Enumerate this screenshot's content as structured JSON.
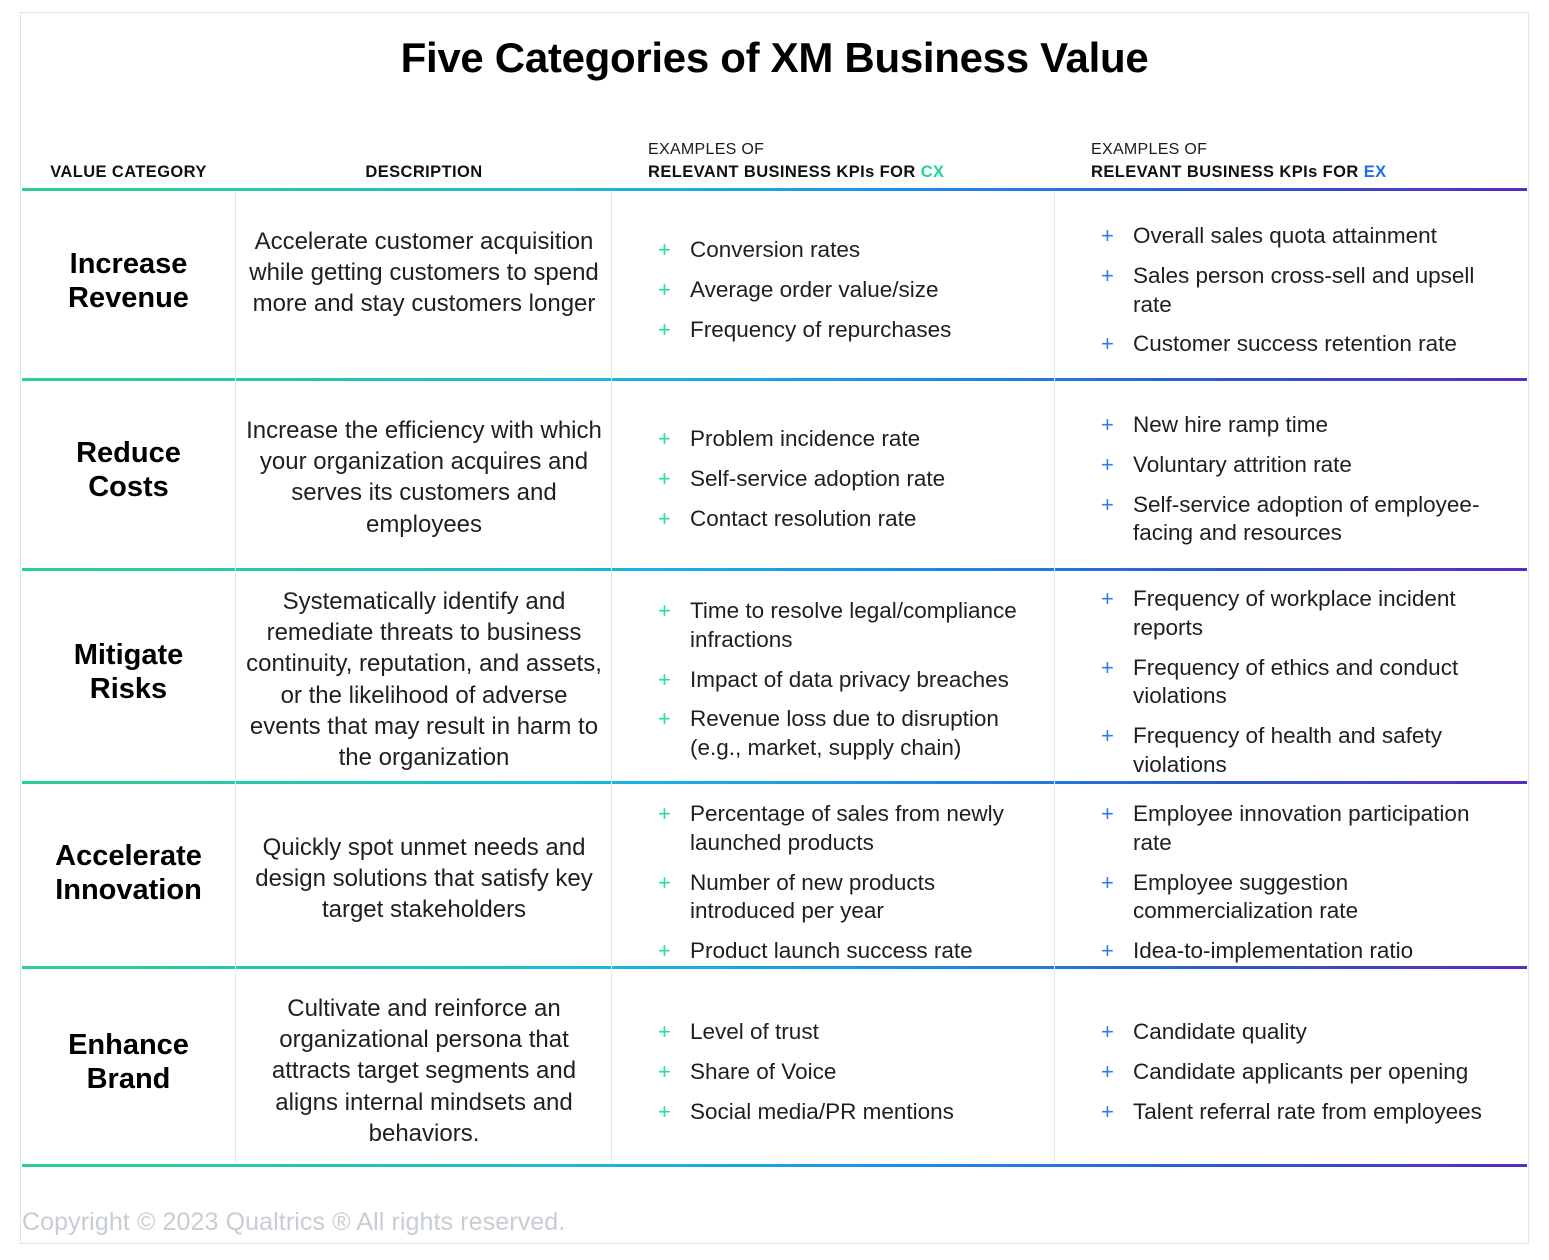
{
  "title": "Five Categories of XM Business Value",
  "colors": {
    "cx_accent": "#22D39B",
    "ex_accent": "#1E6FE8",
    "gradient_start": "#2BD18F",
    "gradient_end": "#5B2AC2",
    "footer_text": "#c7cdd3"
  },
  "columns": {
    "category": {
      "label": "VALUE CATEGORY",
      "eyebrow": ""
    },
    "description": {
      "label": "DESCRIPTION",
      "eyebrow": ""
    },
    "cx": {
      "eyebrow": "EXAMPLES OF",
      "label_prefix": "RELEVANT BUSINESS KPIs FOR ",
      "accent": "CX"
    },
    "ex": {
      "eyebrow": "EXAMPLES OF",
      "label_prefix": "RELEVANT BUSINESS KPIs FOR ",
      "accent": "EX"
    }
  },
  "rows": [
    {
      "category": "Increase\nRevenue",
      "description": "Accelerate customer acquisition while getting customers to spend more and stay customers longer",
      "cx": [
        "Conversion rates",
        "Average order value/size",
        "Frequency of repurchases"
      ],
      "ex": [
        "Overall sales quota attainment",
        "Sales person cross-sell and upsell rate",
        "Customer success retention rate"
      ]
    },
    {
      "category": "Reduce\nCosts",
      "description": "Increase the efficiency with which your organization acquires and serves its customers and employees",
      "cx": [
        "Problem incidence rate",
        "Self-service adoption rate",
        "Contact resolution rate"
      ],
      "ex": [
        "New hire ramp time",
        "Voluntary attrition rate",
        "Self-service adoption of employee-facing and resources"
      ]
    },
    {
      "category": "Mitigate\nRisks",
      "description": "Systematically identify and remediate threats to business continuity, reputation, and assets, or the likelihood of adverse events that may result in harm to the organization",
      "cx": [
        "Time to resolve legal/compliance infractions",
        "Impact of data privacy breaches",
        "Revenue loss due to disruption (e.g., market, supply chain)"
      ],
      "ex": [
        "Frequency of workplace incident reports",
        "Frequency of ethics and conduct violations",
        "Frequency of health and safety violations"
      ]
    },
    {
      "category": "Accelerate\nInnovation",
      "description": "Quickly spot unmet needs and design solutions that satisfy key target stakeholders",
      "cx": [
        "Percentage of sales from newly launched products",
        "Number of new products introduced per year",
        "Product launch success rate"
      ],
      "ex": [
        "Employee innovation participation rate",
        "Employee suggestion commercialization rate",
        "Idea-to-implementation ratio"
      ]
    },
    {
      "category": "Enhance\nBrand",
      "description": "Cultivate and reinforce an organizational persona that attracts target segments and aligns internal mindsets and behaviors.",
      "cx": [
        "Level of trust",
        "Share of Voice",
        "Social media/PR mentions"
      ],
      "ex": [
        "Candidate quality",
        "Candidate applicants per opening",
        "Talent referral rate from employees"
      ]
    }
  ],
  "footer": "Copyright © 2023 Qualtrics ® All rights reserved."
}
